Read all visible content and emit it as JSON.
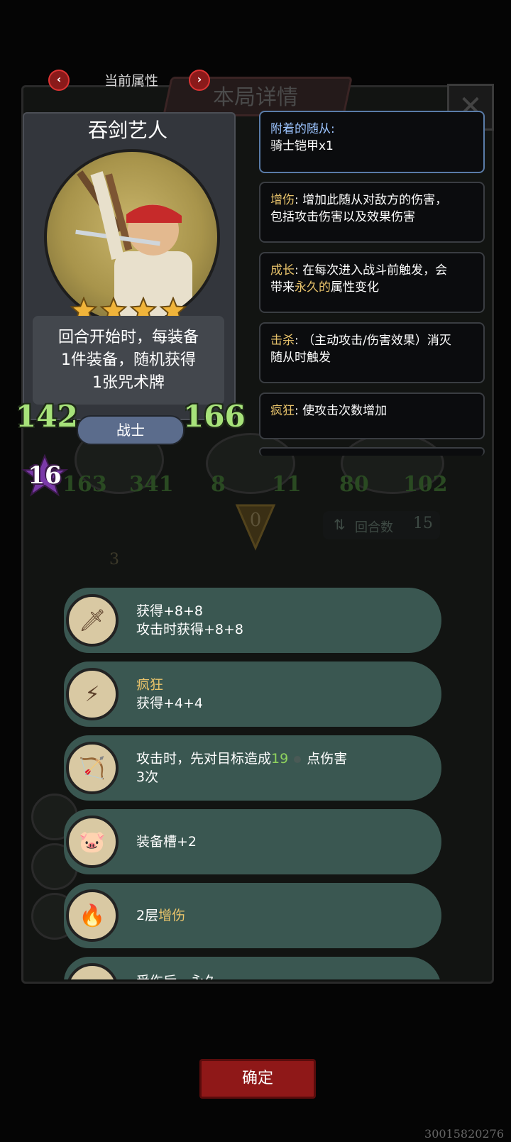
{
  "header": {
    "prev": "‹",
    "title": "当前属性",
    "next": "›"
  },
  "background": {
    "title": "本局详情",
    "close": "✕",
    "enemy_stats": [
      {
        "atk": "163",
        "hp": "341"
      },
      {
        "atk": "8",
        "hp": "11"
      },
      {
        "atk": "80",
        "hp": "102"
      }
    ],
    "center_count": "0",
    "round_label": "回合数",
    "round_value": "15",
    "coin_value": "3"
  },
  "card": {
    "name": "吞剑艺人",
    "stars": 4,
    "description_lines": [
      "回合开始时，每装备",
      "1件装备，随机获得",
      "1张咒术牌"
    ],
    "attack": "142",
    "health": "166",
    "class": "战士",
    "level": "16"
  },
  "keywords": [
    {
      "key": "附着的随从",
      "sep": ":",
      "lines": [
        "骑士铠甲x1"
      ]
    },
    {
      "key": "增伤",
      "sep": ":",
      "lines": [
        "增加此随从对敌方的伤害，",
        "包括攻击伤害以及效果伤害"
      ]
    },
    {
      "key": "成长",
      "sep": ":",
      "line1": "在每次进入战斗前触发，会",
      "line2_pre": "带来",
      "line2_hl": "永久的",
      "line2_post": "属性变化"
    },
    {
      "key": "击杀",
      "sep": ":",
      "lines": [
        "（主动攻击/伤害效果）消灭",
        "随从时触发"
      ]
    },
    {
      "key": "疯狂",
      "sep": ":",
      "lines": [
        "使攻击次数增加"
      ]
    }
  ],
  "equipment": [
    {
      "icon": "golden-sword-icon",
      "line1": "获得+8+8",
      "line2": "攻击时获得+8+8"
    },
    {
      "icon": "lightning-crystal-icon",
      "line1_hl": "疯狂",
      "line2": "获得+4+4"
    },
    {
      "icon": "crossbow-icon",
      "line1_pre": "攻击时，先对目标造成",
      "line1_num": "19",
      "line1_post": "点伤害",
      "line2": "3次"
    },
    {
      "icon": "pig-armor-icon",
      "line1": "装备槽+2"
    },
    {
      "icon": "fire-hand-icon",
      "line1_pre": "2层",
      "line1_hl": "增伤"
    },
    {
      "icon": "wand-icon",
      "line1": "受伤后，永久"
    }
  ],
  "confirm_label": "确定",
  "footer_code": "30015820276",
  "colors": {
    "accent_red": "#8f1818",
    "stat_green": "#a7e27a",
    "keyword_gold": "#e8c36b",
    "equip_teal": "#3a5751"
  }
}
